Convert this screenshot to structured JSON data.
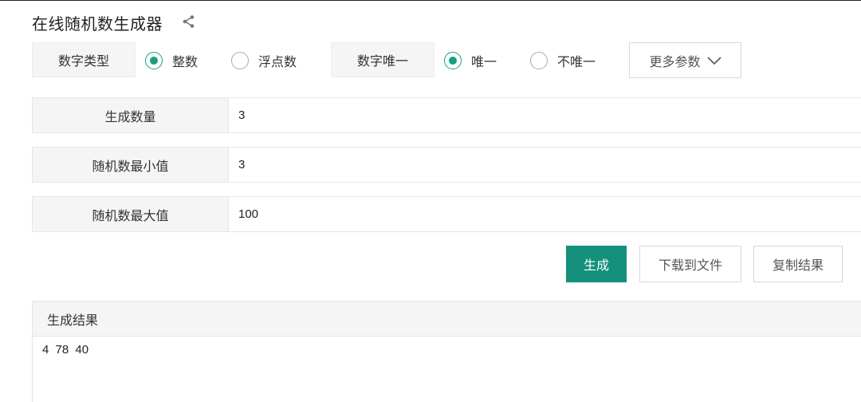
{
  "app": {
    "title": "在线随机数生成器",
    "share_icon": "share-icon"
  },
  "options": {
    "number_type": {
      "label": "数字类型",
      "choices": [
        {
          "label": "整数",
          "checked": true
        },
        {
          "label": "浮点数",
          "checked": false
        }
      ]
    },
    "unique": {
      "label": "数字唯一",
      "choices": [
        {
          "label": "唯一",
          "checked": true
        },
        {
          "label": "不唯一",
          "checked": false
        }
      ]
    },
    "more_label": "更多参数",
    "more_icon": "chevron-down-icon"
  },
  "fields": {
    "count": {
      "label": "生成数量",
      "value": "3"
    },
    "min": {
      "label": "随机数最小值",
      "value": "3"
    },
    "max": {
      "label": "随机数最大值",
      "value": "100"
    }
  },
  "actions": {
    "generate": "生成",
    "download": "下载到文件",
    "copy": "复制结果"
  },
  "result": {
    "header": "生成结果",
    "text": "4  78  40"
  },
  "colors": {
    "accent": "#14a085",
    "primary_button": "#14907c"
  }
}
